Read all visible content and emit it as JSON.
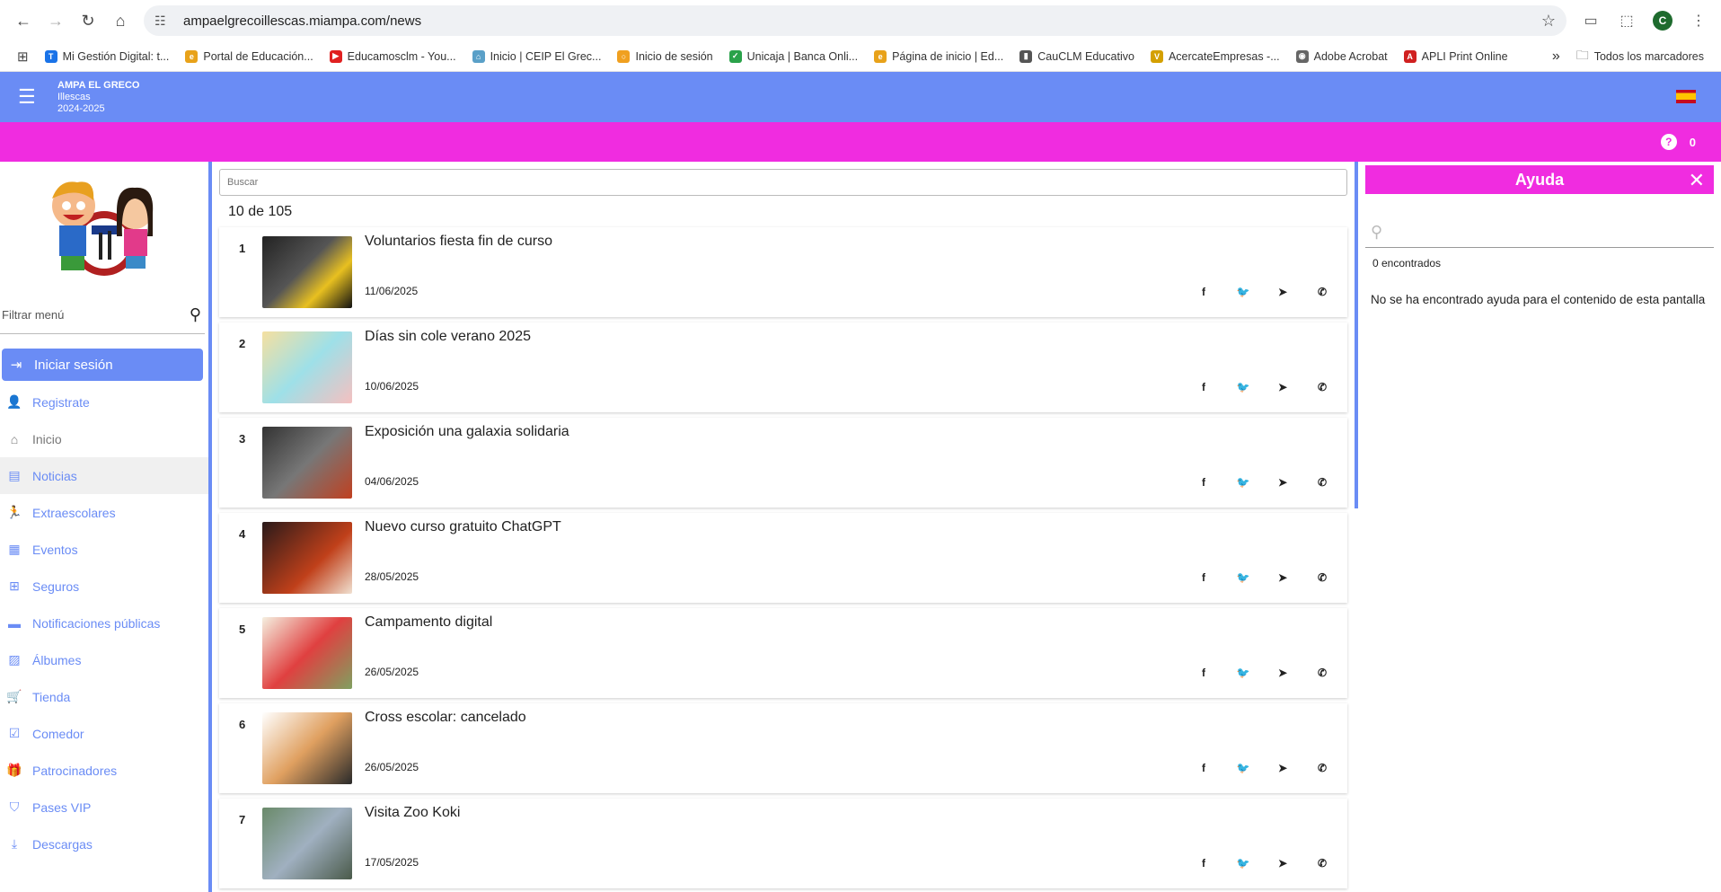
{
  "browser": {
    "url": "ampaelgrecoillescas.miampa.com/news",
    "profile_initial": "C",
    "bookmarks": [
      {
        "label": "Mi Gestión Digital: t...",
        "color": "#1a73e8",
        "glyph": "T"
      },
      {
        "label": "Portal de Educación...",
        "color": "#e8a21a",
        "glyph": "e"
      },
      {
        "label": "Educamosclm - You...",
        "color": "#e02020",
        "glyph": "▶"
      },
      {
        "label": "Inicio | CEIP El Grec...",
        "color": "#5aa0c8",
        "glyph": "⌂"
      },
      {
        "label": "Inicio de sesión",
        "color": "#f0a020",
        "glyph": "○"
      },
      {
        "label": "Unicaja | Banca Onli...",
        "color": "#2aa24a",
        "glyph": "✓"
      },
      {
        "label": "Página de inicio | Ed...",
        "color": "#e8a21a",
        "glyph": "e"
      },
      {
        "label": "CauCLM Educativo",
        "color": "#555555",
        "glyph": "▮"
      },
      {
        "label": "AcercateEmpresas -...",
        "color": "#d4a000",
        "glyph": "V"
      },
      {
        "label": "Adobe Acrobat",
        "color": "#666666",
        "glyph": "◉"
      },
      {
        "label": "APLI Print Online",
        "color": "#d02020",
        "glyph": "A"
      }
    ],
    "all_bookmarks": "Todos los marcadores"
  },
  "header": {
    "title": "AMPA EL GRECO",
    "subtitle": "Illescas",
    "year": "2024-2025",
    "help_count": "0"
  },
  "sidebar": {
    "filter_placeholder": "Filtrar menú",
    "items": [
      {
        "label": "Iniciar sesión",
        "icon": "login-icon"
      },
      {
        "label": "Registrate",
        "icon": "person-add-icon"
      },
      {
        "label": "Inicio",
        "icon": "home-icon"
      },
      {
        "label": "Noticias",
        "icon": "news-icon"
      },
      {
        "label": "Extraescolares",
        "icon": "run-icon"
      },
      {
        "label": "Eventos",
        "icon": "calendar-icon"
      },
      {
        "label": "Seguros",
        "icon": "plus-box-icon"
      },
      {
        "label": "Notificaciones públicas",
        "icon": "message-icon"
      },
      {
        "label": "Álbumes",
        "icon": "image-icon"
      },
      {
        "label": "Tienda",
        "icon": "cart-icon"
      },
      {
        "label": "Comedor",
        "icon": "calendar-check-icon"
      },
      {
        "label": "Patrocinadores",
        "icon": "gift-icon"
      },
      {
        "label": "Pases VIP",
        "icon": "shield-check-icon"
      },
      {
        "label": "Descargas",
        "icon": "download-icon"
      }
    ]
  },
  "news": {
    "search_placeholder": "Buscar",
    "count_text": "10 de 105",
    "items": [
      {
        "num": "1",
        "title": "Voluntarios fiesta fin de curso",
        "date": "11/06/2025"
      },
      {
        "num": "2",
        "title": "Días sin cole verano 2025",
        "date": "10/06/2025"
      },
      {
        "num": "3",
        "title": "Exposición una galaxia solidaria",
        "date": "04/06/2025"
      },
      {
        "num": "4",
        "title": "Nuevo curso gratuito ChatGPT",
        "date": "28/05/2025"
      },
      {
        "num": "5",
        "title": "Campamento digital",
        "date": "26/05/2025"
      },
      {
        "num": "6",
        "title": "Cross escolar: cancelado",
        "date": "26/05/2025"
      },
      {
        "num": "7",
        "title": "Visita Zoo Koki",
        "date": "17/05/2025"
      }
    ]
  },
  "help": {
    "title": "Ayuda",
    "found": "0 encontrados",
    "message": "No se ha encontrado ayuda para el contenido de esta pantalla"
  }
}
